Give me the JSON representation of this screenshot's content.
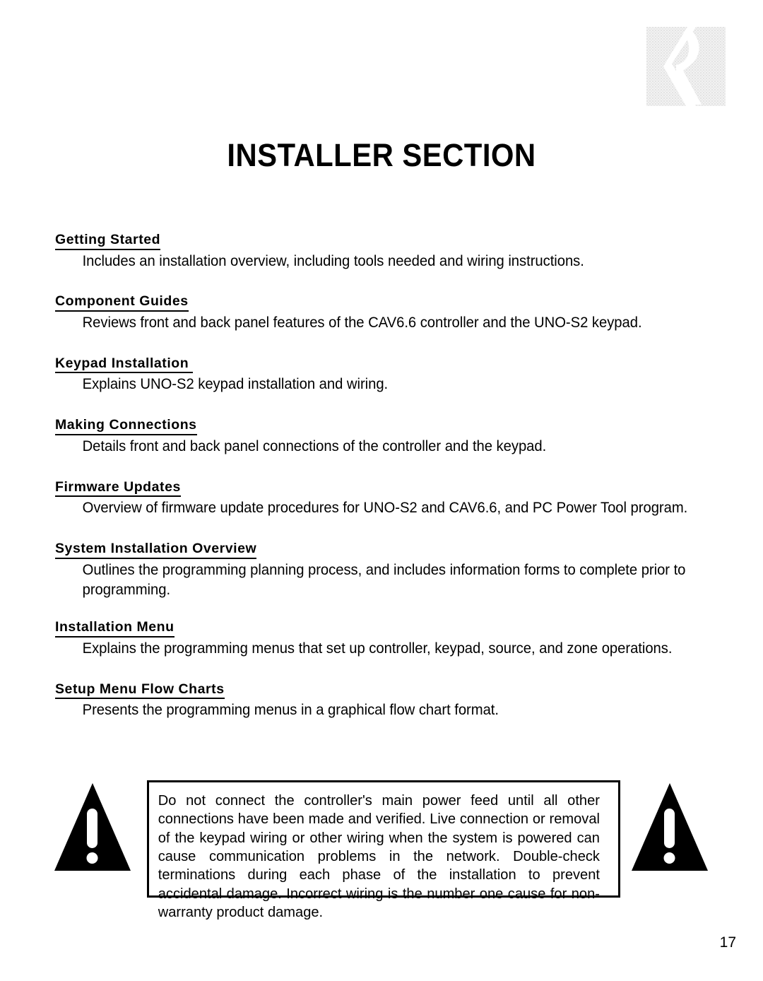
{
  "logo": {
    "icon": "russound-r-logo",
    "color": "#eeeeee"
  },
  "page_title": "INSTALLER SECTION",
  "sections": [
    {
      "heading": "Getting Started",
      "body": "Includes an installation overview, including tools needed and wiring instructions."
    },
    {
      "heading": "Component Guides",
      "body": "Reviews front and back panel features of the CAV6.6 controller and the UNO-S2 keypad."
    },
    {
      "heading": "Keypad Installation ",
      "body": "Explains UNO-S2 keypad installation and wiring."
    },
    {
      "heading": "Making Connections",
      "body": "Details front and back panel connections of the controller and the keypad."
    },
    {
      "heading": "Firmware Updates",
      "body": "Overview of firmware update procedures for UNO-S2 and CAV6.6, and PC Power Tool program."
    },
    {
      "heading": "System Installation Overview",
      "body": "Outlines the programming planning process, and includes information forms to complete prior to programming."
    },
    {
      "heading": "Installation Menu",
      "body": "Explains the programming menus that set up controller, keypad, source, and zone operations."
    },
    {
      "heading": "Setup Menu Flow Charts",
      "body": "Presents the programming menus in a graphical flow chart format."
    }
  ],
  "warning": {
    "icon_left": "warning-triangle-icon",
    "icon_right": "warning-triangle-icon",
    "text": "Do not connect the controller's main power feed until all other connections have been made and verified. Live connection or removal of the keypad wiring or other wiring when the system is powered can cause communication problems in the network.  Double-check terminations during each phase of the installation to prevent accidental damage. Incorrect wiring is the number one cause for non-warranty product damage."
  },
  "page_number": "17"
}
